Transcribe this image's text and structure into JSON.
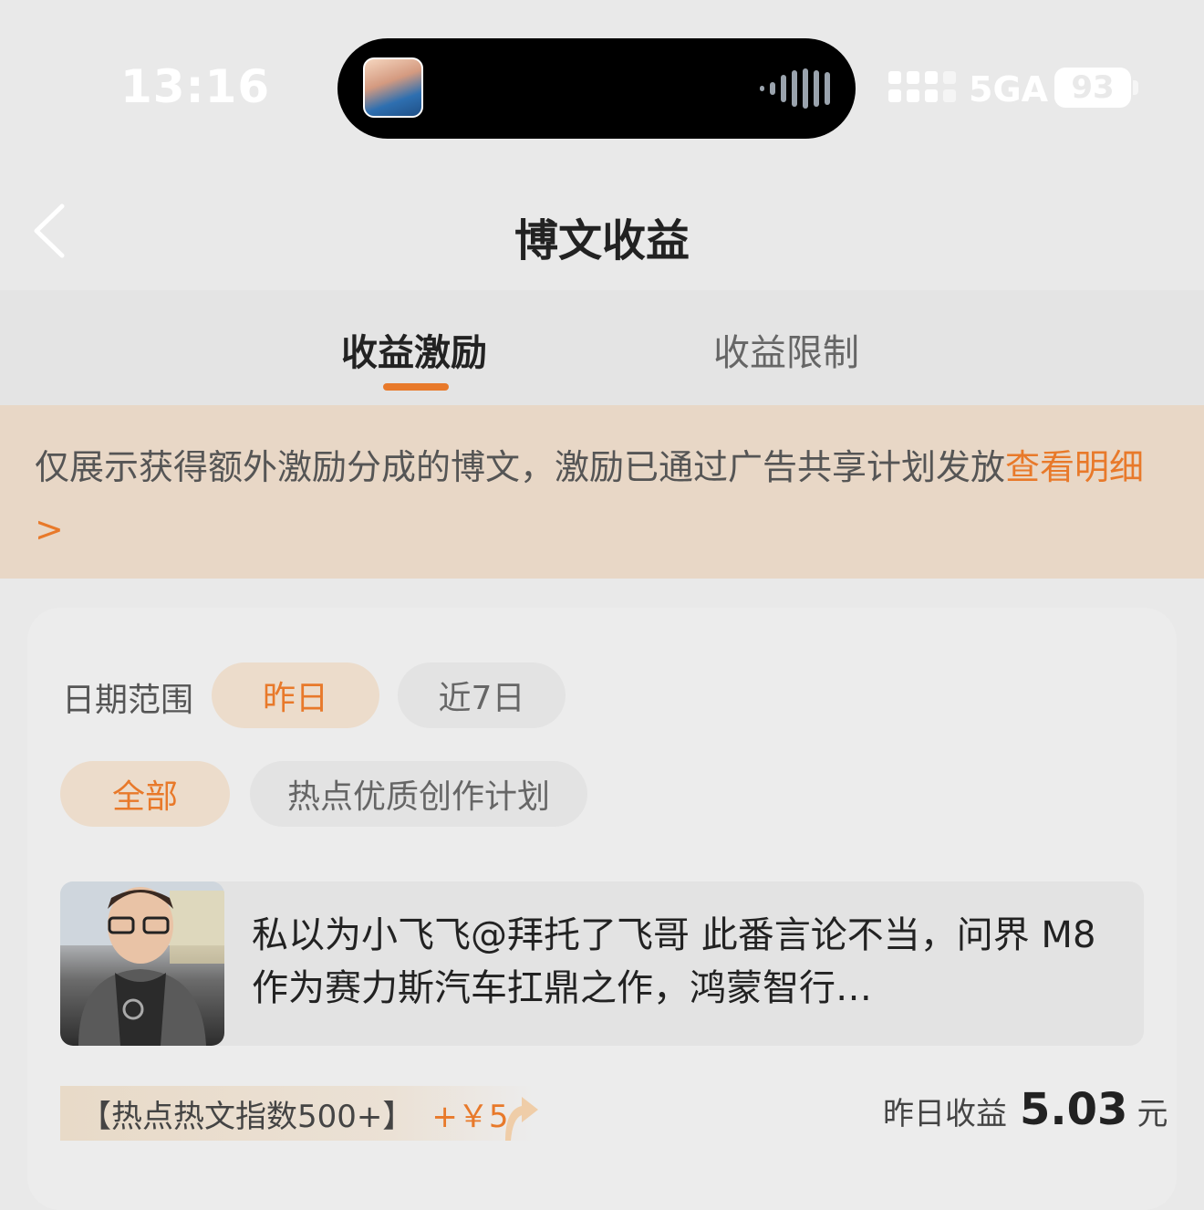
{
  "status_bar": {
    "time": "13:16",
    "network": "5GA",
    "battery": "93"
  },
  "nav": {
    "title": "博文收益",
    "back_icon": "chevron-left-icon"
  },
  "tabs": [
    {
      "label": "收益激励",
      "active": true
    },
    {
      "label": "收益限制",
      "active": false
    }
  ],
  "notice": {
    "text": "仅展示获得额外激励分成的博文，激励已通过广告共享计划发放",
    "link": "查看明细>"
  },
  "filters": {
    "date_label": "日期范围",
    "date_options": [
      {
        "label": "昨日",
        "selected": true
      },
      {
        "label": "近7日",
        "selected": false
      }
    ],
    "type_options": [
      {
        "label": "全部",
        "selected": true
      },
      {
        "label": "热点优质创作计划",
        "selected": false
      }
    ]
  },
  "post": {
    "text": "私以为小飞飞@拜托了飞哥 此番言论不当，问界 M8 作为赛力斯汽车扛鼎之作，鸿蒙智行…",
    "tag": "【热点热文指数500+】",
    "bonus": "+￥5",
    "earnings_label": "昨日收益",
    "earnings_value": "5.03",
    "earnings_unit": "元"
  },
  "colors": {
    "accent": "#e8792a",
    "notice_bg": "#e8d7c6",
    "chip_selected_bg": "#ecdccb"
  }
}
